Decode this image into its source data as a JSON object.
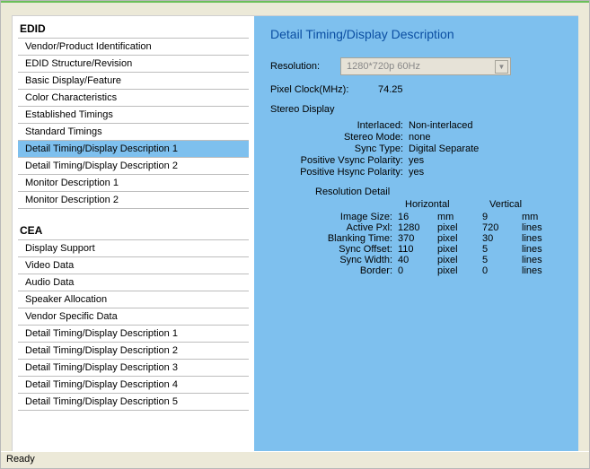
{
  "status": "Ready",
  "sidebar": {
    "blocks": [
      {
        "header": "EDID",
        "items": [
          {
            "label": "Vendor/Product Identification",
            "selected": false
          },
          {
            "label": "EDID Structure/Revision",
            "selected": false
          },
          {
            "label": "Basic Display/Feature",
            "selected": false
          },
          {
            "label": "Color Characteristics",
            "selected": false
          },
          {
            "label": "Established Timings",
            "selected": false
          },
          {
            "label": "Standard Timings",
            "selected": false
          },
          {
            "label": "Detail Timing/Display Description 1",
            "selected": true
          },
          {
            "label": "Detail Timing/Display Description 2",
            "selected": false
          },
          {
            "label": "Monitor Description 1",
            "selected": false
          },
          {
            "label": "Monitor Description 2",
            "selected": false
          }
        ]
      },
      {
        "header": "CEA",
        "items": [
          {
            "label": "Display Support",
            "selected": false
          },
          {
            "label": "Video Data",
            "selected": false
          },
          {
            "label": "Audio Data",
            "selected": false
          },
          {
            "label": "Speaker Allocation",
            "selected": false
          },
          {
            "label": "Vendor Specific Data",
            "selected": false
          },
          {
            "label": "Detail Timing/Display Description 1",
            "selected": false
          },
          {
            "label": "Detail Timing/Display Description 2",
            "selected": false
          },
          {
            "label": "Detail Timing/Display Description 3",
            "selected": false
          },
          {
            "label": "Detail Timing/Display Description 4",
            "selected": false
          },
          {
            "label": "Detail Timing/Display Description 5",
            "selected": false
          }
        ]
      }
    ]
  },
  "detail": {
    "title": "Detail Timing/Display Description",
    "resolution_label": "Resolution:",
    "resolution_value": "1280*720p 60Hz",
    "pixel_clock_label": "Pixel Clock(MHz):",
    "pixel_clock_value": "74.25",
    "stereo_header": "Stereo Display",
    "stereo": [
      {
        "k": "Interlaced:",
        "v": "Non-interlaced"
      },
      {
        "k": "Stereo Mode:",
        "v": "none"
      },
      {
        "k": "Sync Type:",
        "v": "Digital Separate"
      },
      {
        "k": "Positive Vsync Polarity:",
        "v": "yes"
      },
      {
        "k": "Positive Hsync Polarity:",
        "v": "yes"
      }
    ],
    "resdet_header": "Resolution Detail",
    "resdet_col_h": "Horizontal",
    "resdet_col_v": "Vertical",
    "resdet": [
      {
        "k": "Image Size:",
        "hn": "16",
        "hu": "mm",
        "vn": "9",
        "vu": "mm"
      },
      {
        "k": "Active Pxl:",
        "hn": "1280",
        "hu": "pixel",
        "vn": "720",
        "vu": "lines"
      },
      {
        "k": "Blanking Time:",
        "hn": "370",
        "hu": "pixel",
        "vn": "30",
        "vu": "lines"
      },
      {
        "k": "Sync Offset:",
        "hn": "110",
        "hu": "pixel",
        "vn": "5",
        "vu": "lines"
      },
      {
        "k": "Sync Width:",
        "hn": "40",
        "hu": "pixel",
        "vn": "5",
        "vu": "lines"
      },
      {
        "k": "Border:",
        "hn": "0",
        "hu": "pixel",
        "vn": "0",
        "vu": "lines"
      }
    ]
  }
}
